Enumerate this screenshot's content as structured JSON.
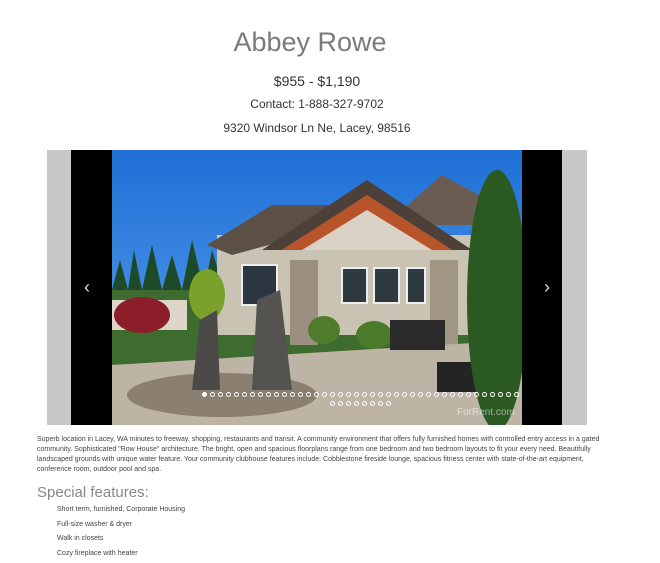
{
  "listing": {
    "name": "Abbey Rowe",
    "price": "$955 - $1,190",
    "contact": "Contact: 1-888-327-9702",
    "address": "9320 Windsor Ln Ne, Lacey, 98516"
  },
  "carousel": {
    "prev_icon": "chevron-left-icon",
    "next_icon": "chevron-right-icon",
    "prev_glyph": "‹",
    "next_glyph": "›",
    "watermark": "ForRent.com",
    "slide_count": 48,
    "active_slide": 1,
    "colors": {
      "side_panels": "#c8c8c8",
      "frame": "#000000",
      "dot": "#ffffff"
    }
  },
  "description": "Superb location in Lacey, WA minutes to freeway, shopping, restaurants and transit. A community environment that offers fully furnished homes with controlled entry access in a gated community. Sophisticated \"Row House\" architecture. The bright, open and spacious floorplans range from one bedroom and two bedroom layouts to fit your every need. Beautifully landscaped grounds with unique water feature. Your community clubhouse features include: Cobblestone fireside lounge, spacious fitness center with state-of-the-art equipment, conference room, outdoor pool and spa.",
  "features": {
    "title": "Special features:",
    "items": [
      "Short term, furnished, Corporate Housing",
      "Full-size washer & dryer",
      "Walk in closets",
      "Cozy fireplace with heater"
    ]
  }
}
